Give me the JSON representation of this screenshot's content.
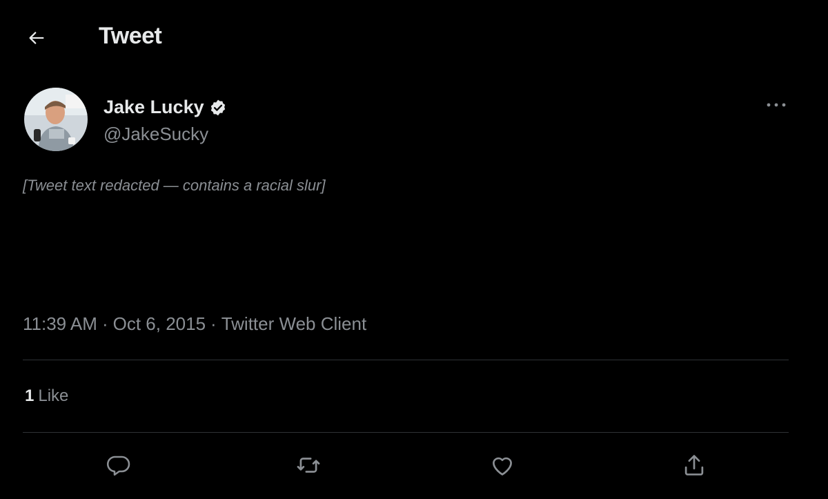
{
  "header": {
    "title": "Tweet",
    "back_icon": "arrow-left-icon"
  },
  "author": {
    "display_name": "Jake Lucky",
    "handle": "@JakeSucky",
    "verified": true
  },
  "tweet": {
    "text": "[Tweet text redacted — contains a racial slur]",
    "time": "11:39 AM",
    "date": "Oct 6, 2015",
    "client": "Twitter Web Client",
    "separator": "·"
  },
  "stats": {
    "likes_count": "1",
    "likes_label": "Like"
  },
  "actions": [
    "reply-icon",
    "retweet-icon",
    "like-icon",
    "share-icon"
  ],
  "colors": {
    "background": "#000000",
    "text": "#e7e9ea",
    "secondary": "#8b8f94",
    "divider": "#2f3336"
  }
}
